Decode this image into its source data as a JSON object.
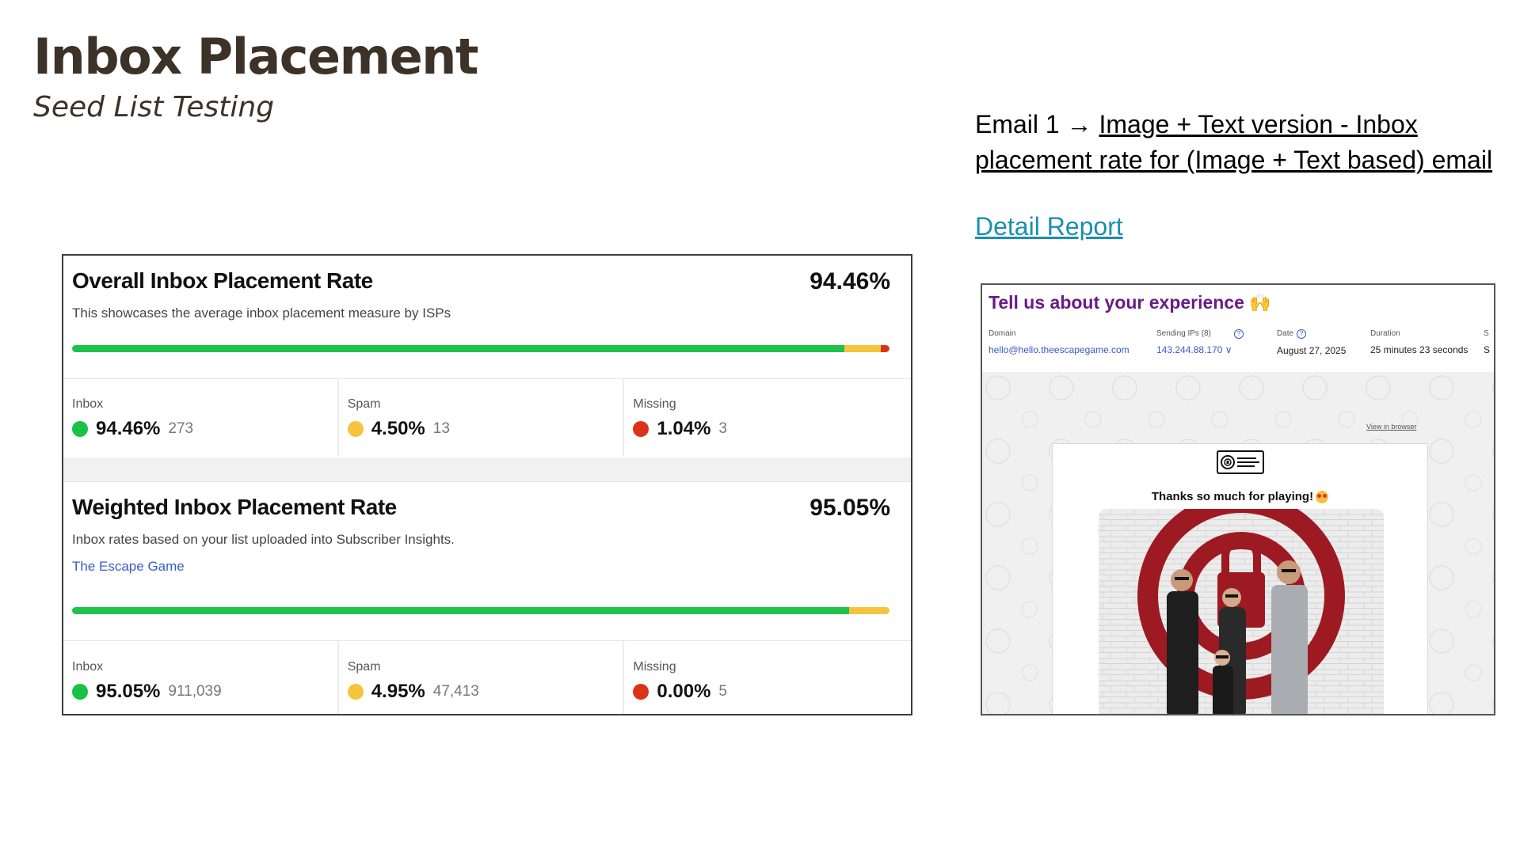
{
  "header": {
    "title": "Inbox Placement",
    "subtitle": "Seed List Testing"
  },
  "email_info": {
    "prefix": "Email 1 → ",
    "link_text": "Image + Text version - Inbox placement rate for (Image + Text based) email",
    "detail_report": "Detail Report"
  },
  "overall": {
    "title": "Overall Inbox Placement Rate",
    "rate": "94.46%",
    "description": "This showcases the average inbox placement measure by ISPs",
    "distribution": {
      "inbox": 94.46,
      "spam": 4.5,
      "missing": 1.04
    },
    "metrics": [
      {
        "label": "Inbox",
        "pct": "94.46%",
        "count": "273",
        "color": "#19c246"
      },
      {
        "label": "Spam",
        "pct": "4.50%",
        "count": "13",
        "color": "#f6c43c"
      },
      {
        "label": "Missing",
        "pct": "1.04%",
        "count": "3",
        "color": "#dc3318"
      }
    ]
  },
  "weighted": {
    "title": "Weighted Inbox Placement Rate",
    "rate": "95.05%",
    "description": "Inbox rates based on your list uploaded into Subscriber Insights.",
    "link": "The Escape Game",
    "distribution": {
      "inbox": 95.05,
      "spam": 4.95,
      "missing": 0.0
    },
    "metrics": [
      {
        "label": "Inbox",
        "pct": "95.05%",
        "count": "911,039",
        "color": "#19c246"
      },
      {
        "label": "Spam",
        "pct": "4.95%",
        "count": "47,413",
        "color": "#f6c43c"
      },
      {
        "label": "Missing",
        "pct": "0.00%",
        "count": "5",
        "color": "#dc3318"
      }
    ]
  },
  "email_preview": {
    "title": "Tell us about your experience",
    "domain_label": "Domain",
    "domain_value": "hello@hello.theescapegame.com",
    "sending_ips_label": "Sending IPs (8)",
    "sending_ips_value": "143.244.88.170",
    "date_label": "Date",
    "date_value": "August 27, 2025",
    "duration_label": "Duration",
    "duration_value": "25 minutes 23 seconds",
    "extra_label": "S",
    "extra_value": "S",
    "view_in_browser": "View in browser",
    "logo_text": "THE ESCAPE GAME",
    "thanks_text": "Thanks so much for playing!"
  }
}
